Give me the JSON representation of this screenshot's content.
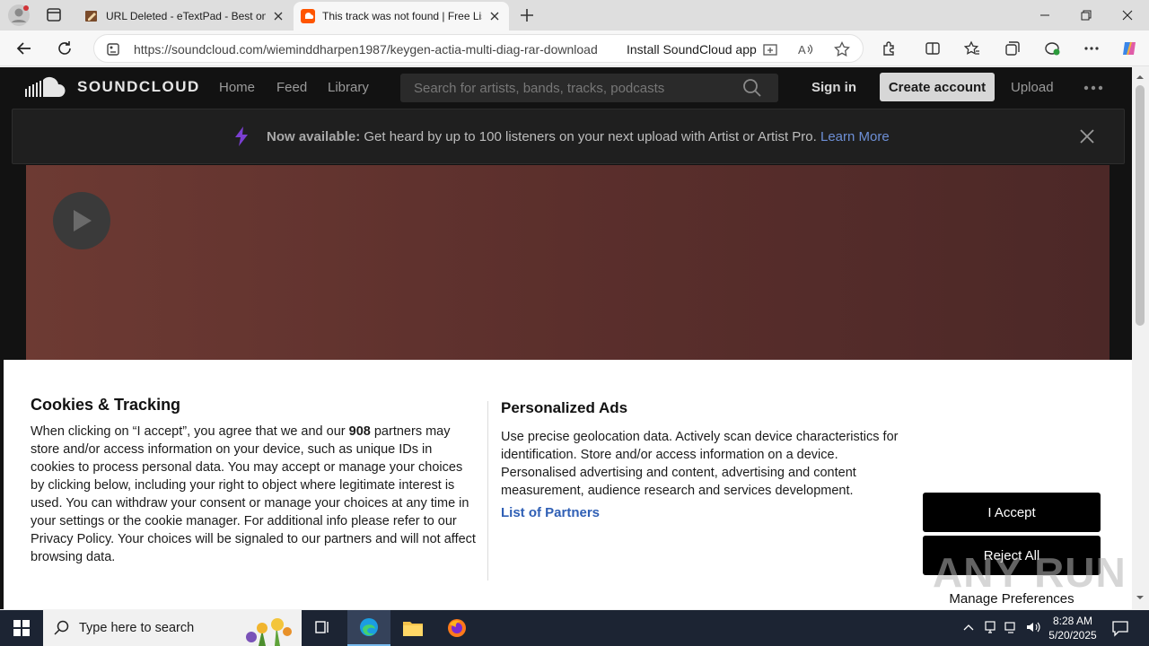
{
  "browser": {
    "tabs": [
      {
        "title": "URL Deleted - eTextPad - Best onl",
        "active": false
      },
      {
        "title": "This track was not found | Free Lis",
        "active": true
      }
    ],
    "address": {
      "url": "https://soundcloud.com/wieminddharpen1987/keygen-actia-multi-diag-rar-download",
      "install_label": "Install SoundCloud app"
    }
  },
  "soundcloud": {
    "brand": "SOUNDCLOUD",
    "nav": [
      "Home",
      "Feed",
      "Library"
    ],
    "search_placeholder": "Search for artists, bands, tracks, podcasts",
    "sign_in": "Sign in",
    "create_account": "Create account",
    "upload": "Upload",
    "banner": {
      "bold": "Now available:",
      "text": " Get heard by up to 100 listeners on your next upload with Artist or Artist Pro. ",
      "link": "Learn More"
    }
  },
  "consent": {
    "title": "Cookies & Tracking",
    "body_pre": "When clicking on “I accept”, you agree that we and our ",
    "partner_count": "908",
    "body_post": " partners may store and/or access information on your device, such as unique IDs in cookies to process personal data. You may accept or manage your choices by clicking below, including your right to object where legitimate interest is used. You can withdraw your consent or manage your choices at any time in your settings or the cookie manager. For additional info please refer to our Privacy Policy. Your choices will be signaled to our partners and will not affect browsing data.",
    "ads_title": "Personalized Ads",
    "ads_body": "Use precise geolocation data. Actively scan device characteristics for identification. Store and/or access information on a device. Personalised advertising and content, advertising and content measurement, audience research and services development.",
    "partners_link": "List of Partners",
    "accept": "I Accept",
    "reject": "Reject All",
    "manage": "Manage Preferences",
    "watermark": "ANY RUN"
  },
  "taskbar": {
    "search_placeholder": "Type here to search",
    "time": "8:28 AM",
    "date": "5/20/2025"
  },
  "colors": {
    "sc_background": "#121212",
    "hero_start": "#6d3a33",
    "link_blue": "#2f5fb5",
    "taskbar": "#1c2433"
  }
}
